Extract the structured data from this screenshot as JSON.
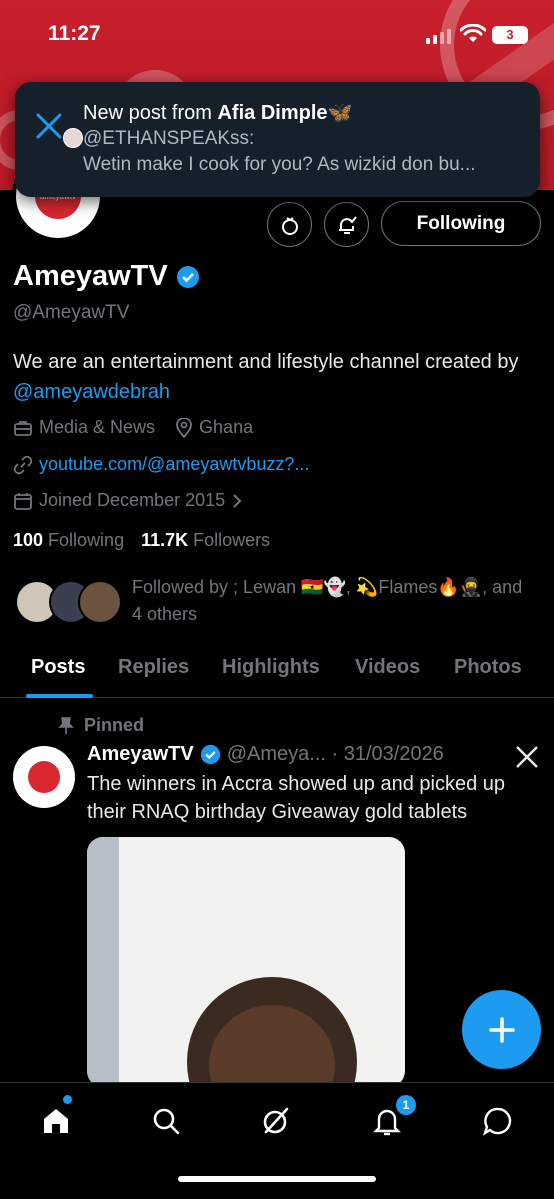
{
  "status_bar": {
    "time": "11:27",
    "battery": "3"
  },
  "notification": {
    "title_prefix": "New post from ",
    "title_name": "Afia Dimple",
    "title_emoji": "🦋",
    "line1": "@ETHANSPEAKss:",
    "line2": "Wetin make I cook for you? As wizkid don bu..."
  },
  "profile": {
    "name": "AmeyawTV",
    "handle": "@AmeyawTV",
    "follow_button": "Following",
    "bio_text": "We are an entertainment and lifestyle channel created by ",
    "bio_link": "@ameyawdebrah",
    "category": "Media & News",
    "location": "Ghana",
    "website": "youtube.com/@ameyawtvbuzz?...",
    "joined": "Joined December 2015",
    "following_count": "100",
    "following_label": " Following",
    "followers_count": "11.7K",
    "followers_label": " Followers",
    "followed_by": "Followed by ; Lewan 🇬🇭👻, 💫Flames🔥🥷, and 4 others",
    "avatar_text": "ameyawtv"
  },
  "tabs": [
    "Posts",
    "Replies",
    "Highlights",
    "Videos",
    "Photos"
  ],
  "post": {
    "pinned_label": "Pinned",
    "name": "AmeyawTV",
    "handle_date": "@Ameya... · 31/03/2026",
    "text": "The winners in Accra showed up and picked up their RNAQ birthday Giveaway gold tablets"
  },
  "nav": {
    "notifications_badge": "1"
  },
  "colors": {
    "accent": "#1d9bf0",
    "banner": "#c8202c",
    "background": "#000000"
  }
}
